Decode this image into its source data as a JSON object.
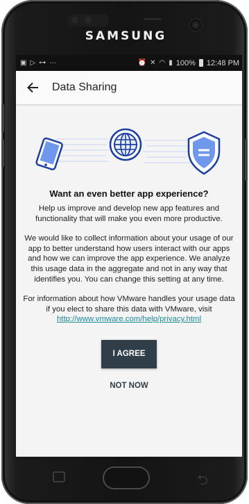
{
  "device": {
    "brand": "SAMSUNG"
  },
  "status_bar": {
    "left_icons": [
      "image-icon",
      "play-icon",
      "key-icon",
      "more-icon"
    ],
    "battery": "100%",
    "time": "12:48 PM"
  },
  "app_bar": {
    "title": "Data Sharing"
  },
  "content": {
    "heading": "Want an even better app experience?",
    "para1": "Help us improve and develop new app features and functionality that will make you even more productive.",
    "para2": "We would like to collect information about your usage of our app to better understand how users interact with our apps and how we can improve the app experience. We analyze this usage data in the aggregate and not in any way that identifies you. You can change this setting at any time.",
    "para3": "For information about how VMware handles your usage data if you elect to share this data with VMware, visit",
    "link": "http://www.vmware.com/help/privacy.html"
  },
  "buttons": {
    "agree": "I AGREE",
    "not_now": "NOT NOW"
  },
  "colors": {
    "accent": "#2f3e48",
    "link": "#1d8a9b",
    "illustration": "#2b5fd9"
  }
}
